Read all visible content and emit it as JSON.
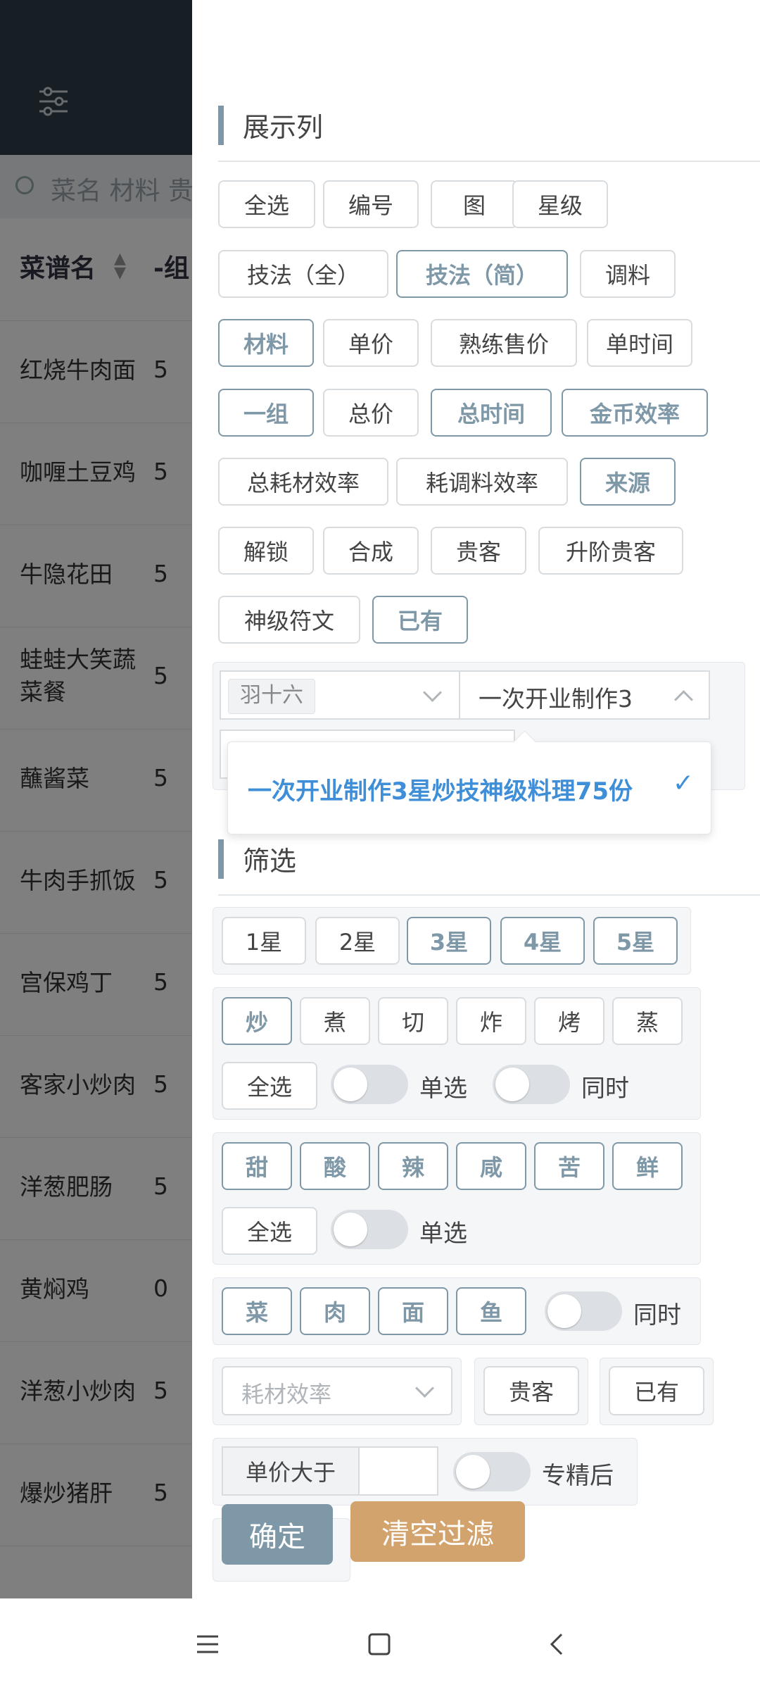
{
  "background": {
    "search_placeholder": "菜名 材料 贵",
    "col_header_1": "菜谱名",
    "col_header_2": "-组",
    "rows": [
      {
        "name": "红烧牛肉面",
        "val": "5"
      },
      {
        "name": "咖喱土豆鸡",
        "val": "5"
      },
      {
        "name": "牛隐花田",
        "val": "5"
      },
      {
        "name": "蛙蛙大笑蔬菜餐",
        "val": "5"
      },
      {
        "name": "蘸酱菜",
        "val": "5"
      },
      {
        "name": "牛肉手抓饭",
        "val": "5"
      },
      {
        "name": "宫保鸡丁",
        "val": "5"
      },
      {
        "name": "客家小炒肉",
        "val": "5"
      },
      {
        "name": "洋葱肥肠",
        "val": "5"
      },
      {
        "name": "黄焖鸡",
        "val": "0"
      },
      {
        "name": "洋葱小炒肉",
        "val": "5"
      },
      {
        "name": "爆炒猪肝",
        "val": "5"
      }
    ]
  },
  "columns_section": {
    "title": "展示列",
    "buttons": [
      {
        "label": "全选",
        "active": false
      },
      {
        "label": "编号",
        "active": false
      },
      {
        "label": "图",
        "active": false
      },
      {
        "label": "星级",
        "active": false
      },
      {
        "label": "技法（全）",
        "active": false
      },
      {
        "label": "技法（简）",
        "active": true
      },
      {
        "label": "调料",
        "active": false
      },
      {
        "label": "材料",
        "active": true
      },
      {
        "label": "单价",
        "active": false
      },
      {
        "label": "熟练售价",
        "active": false
      },
      {
        "label": "单时间",
        "active": false
      },
      {
        "label": "一组",
        "active": true
      },
      {
        "label": "总价",
        "active": false
      },
      {
        "label": "总时间",
        "active": true
      },
      {
        "label": "金币效率",
        "active": true
      },
      {
        "label": "总耗材效率",
        "active": false
      },
      {
        "label": "耗调料效率",
        "active": false
      },
      {
        "label": "来源",
        "active": true
      },
      {
        "label": "解锁",
        "active": false
      },
      {
        "label": "合成",
        "active": false
      },
      {
        "label": "贵客",
        "active": false
      },
      {
        "label": "升阶贵客",
        "active": false
      },
      {
        "label": "神级符文",
        "active": false
      },
      {
        "label": "已有",
        "active": true
      }
    ],
    "select_chef": "羽十六",
    "select_task": "一次开业制作3",
    "dropdown_option": "一次开业制作3星炒技神级料理75份"
  },
  "filter_section": {
    "title": "筛选",
    "stars": [
      {
        "label": "1星",
        "active": false
      },
      {
        "label": "2星",
        "active": false
      },
      {
        "label": "3星",
        "active": true
      },
      {
        "label": "4星",
        "active": true
      },
      {
        "label": "5星",
        "active": true
      }
    ],
    "skills": [
      {
        "label": "炒",
        "active": true
      },
      {
        "label": "煮",
        "active": false
      },
      {
        "label": "切",
        "active": false
      },
      {
        "label": "炸",
        "active": false
      },
      {
        "label": "烤",
        "active": false
      },
      {
        "label": "蒸",
        "active": false
      }
    ],
    "skills_select_all": "全选",
    "single_select": "单选",
    "same_time": "同时",
    "tastes": [
      {
        "label": "甜",
        "active": true
      },
      {
        "label": "酸",
        "active": true
      },
      {
        "label": "辣",
        "active": true
      },
      {
        "label": "咸",
        "active": true
      },
      {
        "label": "苦",
        "active": true
      },
      {
        "label": "鲜",
        "active": true
      }
    ],
    "tastes_select_all": "全选",
    "tastes_single": "单选",
    "materials": [
      {
        "label": "菜",
        "active": true
      },
      {
        "label": "肉",
        "active": true
      },
      {
        "label": "面",
        "active": true
      },
      {
        "label": "鱼",
        "active": true
      }
    ],
    "materials_same_time": "同时",
    "efficiency_placeholder": "耗材效率",
    "guest_button": "贵客",
    "owned_button": "已有",
    "price_greater_label": "单价大于",
    "price_greater_value": "",
    "after_mastery": "专精后",
    "confirm": "确定",
    "clear_filter": "清空过滤"
  },
  "colors": {
    "accent": "#7f98a8",
    "confirm_bg": "#7f98a8",
    "clear_bg": "#d3a36d",
    "dropdown_text": "#3e8ed8",
    "header_bg": "#2f3d48"
  }
}
